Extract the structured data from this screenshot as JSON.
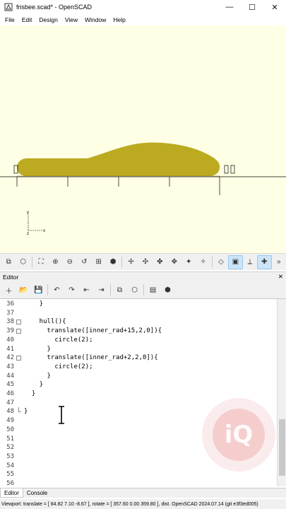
{
  "window": {
    "title": "frisbee.scad* - OpenSCAD",
    "controls": {
      "minimize": "—",
      "maximize": "☐",
      "close": "✕"
    }
  },
  "menubar": {
    "items": [
      "File",
      "Edit",
      "Design",
      "View",
      "Window",
      "Help"
    ]
  },
  "viewport": {
    "background": "#ffffe5",
    "model_color": "#bcaa21",
    "axis_labels": {
      "y": "y",
      "z": "z",
      "x": "x"
    }
  },
  "view_toolbar": {
    "icons": [
      "preview-icon",
      "render-icon",
      "view-all-icon",
      "zoom-in-icon",
      "zoom-out-icon",
      "reset-view-icon",
      "view-right-icon",
      "view-top-icon",
      "view-bottom-icon",
      "view-left-icon",
      "view-right-icon",
      "view-front-icon",
      "view-back-icon",
      "view-diagonal-icon",
      "view-center-icon",
      "perspective-icon",
      "orthogonal-icon",
      "show-axes-icon",
      "show-crosshairs-icon"
    ],
    "overflow": "»"
  },
  "editor_dock": {
    "title": "Editor",
    "close": "✕"
  },
  "editor_toolbar": {
    "icons": [
      "new-file-icon",
      "open-file-icon",
      "save-icon",
      "undo-icon",
      "redo-icon",
      "unindent-icon",
      "indent-icon",
      "preview-icon",
      "render-icon",
      "export-stl-icon",
      "export-3d-icon"
    ]
  },
  "editor": {
    "lines": [
      {
        "n": "36",
        "code": "    }"
      },
      {
        "n": "37",
        "code": ""
      },
      {
        "n": "38",
        "code": "    hull(){"
      },
      {
        "n": "39",
        "code": "      translate([inner_rad+15,2,0]){"
      },
      {
        "n": "40",
        "code": "        circle(2);"
      },
      {
        "n": "41",
        "code": "      }"
      },
      {
        "n": "42",
        "code": "      translate([inner_rad+2,2,0]){"
      },
      {
        "n": "43",
        "code": "        circle(2);"
      },
      {
        "n": "44",
        "code": "      }"
      },
      {
        "n": "45",
        "code": "    }"
      },
      {
        "n": "46",
        "code": "  }"
      },
      {
        "n": "47",
        "code": ""
      },
      {
        "n": "48",
        "code": "}"
      },
      {
        "n": "49",
        "code": ""
      },
      {
        "n": "50",
        "code": ""
      },
      {
        "n": "51",
        "code": ""
      },
      {
        "n": "52",
        "code": ""
      },
      {
        "n": "53",
        "code": ""
      },
      {
        "n": "54",
        "code": ""
      },
      {
        "n": "55",
        "code": ""
      },
      {
        "n": "56",
        "code": ""
      }
    ],
    "watermark": "iQ"
  },
  "bottom_tabs": [
    "Editor",
    "Console"
  ],
  "status": {
    "text": "Viewport: translate = [ 84.82 7.10 -8.67 ], rotate = [ 357.60 0.00 359.80 ], dist. OpenSCAD 2024.07.14 (git e3f3ed005)"
  }
}
